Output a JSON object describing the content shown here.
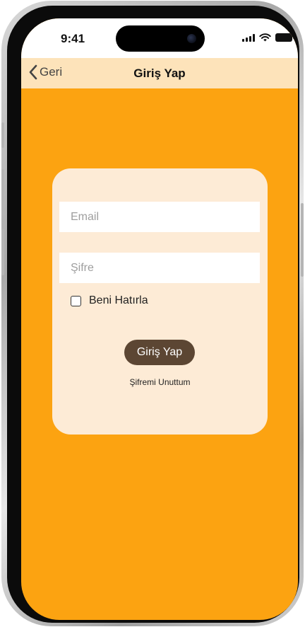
{
  "status_bar": {
    "time": "9:41",
    "icons": [
      "cellular-signal-icon",
      "wifi-icon",
      "battery-icon"
    ]
  },
  "nav": {
    "back_label": "Geri",
    "back_icon": "chevron-left-icon",
    "title": "Giriş Yap"
  },
  "form": {
    "email_placeholder": "Email",
    "email_value": "",
    "password_placeholder": "Şifre",
    "password_value": "",
    "remember_label": "Beni Hatırla",
    "remember_checked": false,
    "login_label": "Giriş Yap",
    "forgot_label": "Şifremi Unuttum"
  },
  "colors": {
    "background": "#fca311",
    "nav_background": "#fde3ba",
    "card_background": "#fdebd6",
    "button_background": "#5c4633",
    "button_text": "#ffffff"
  }
}
